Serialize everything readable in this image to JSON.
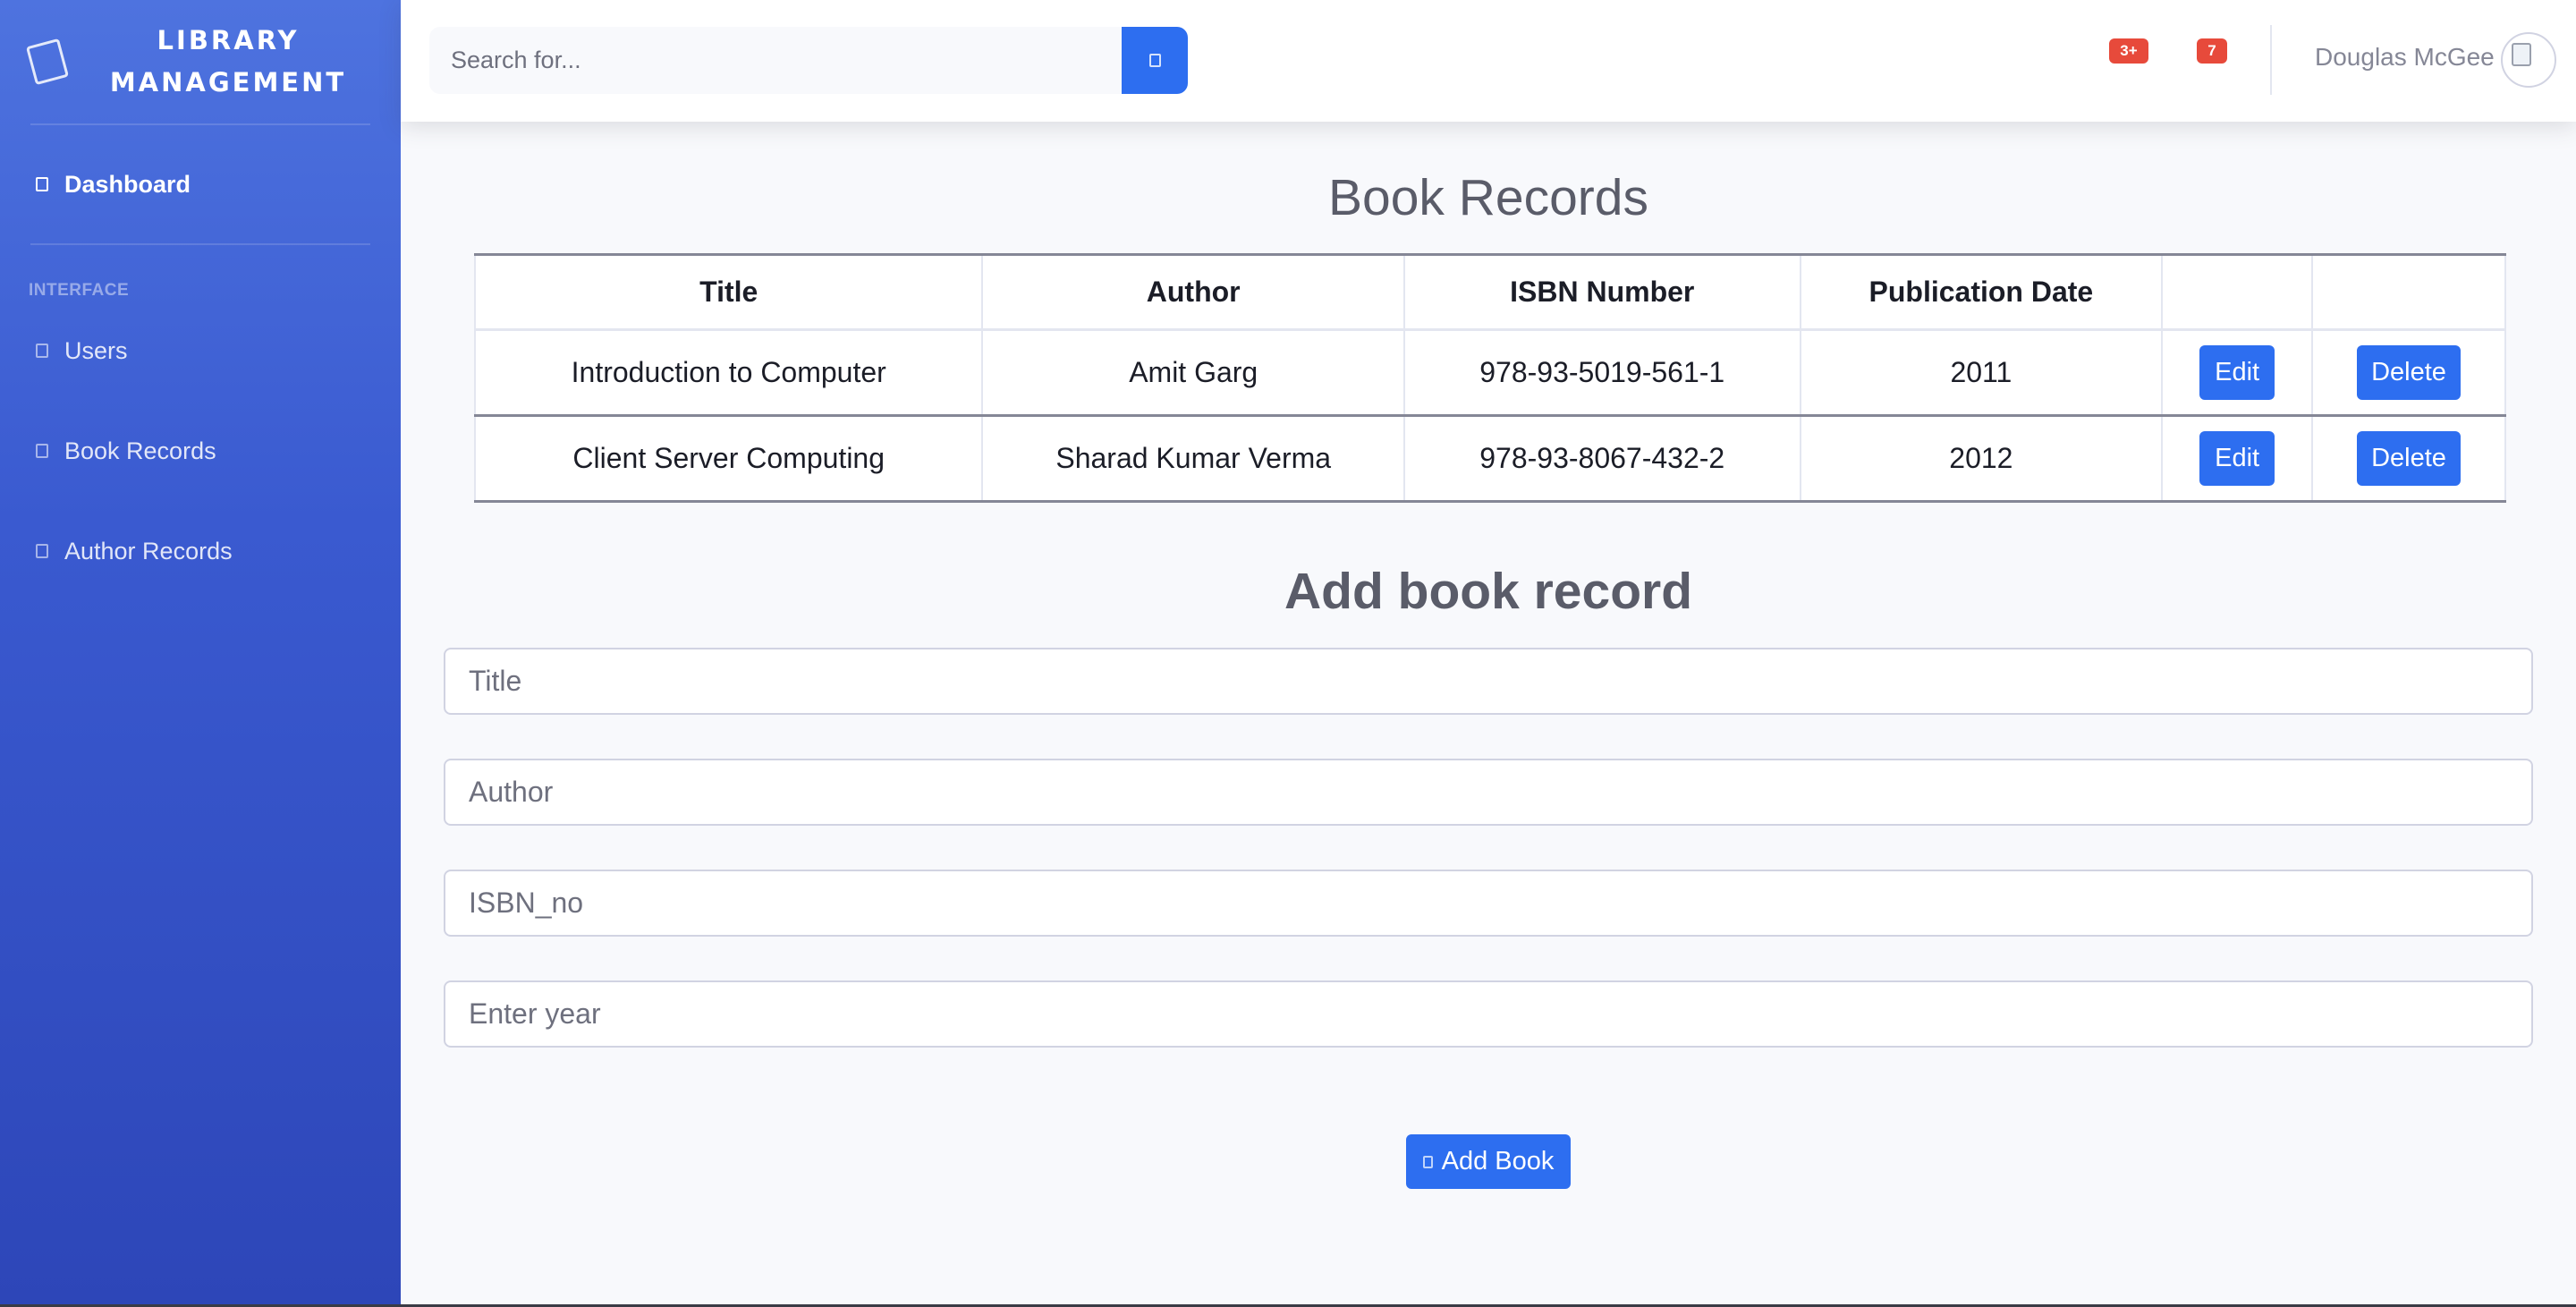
{
  "brand": {
    "line1": "LIBRARY",
    "line2": "MANAGEMENT"
  },
  "sidebar": {
    "dashboard_label": "Dashboard",
    "heading": "INTERFACE",
    "items": [
      {
        "label": "Users"
      },
      {
        "label": "Book Records"
      },
      {
        "label": "Author Records"
      }
    ]
  },
  "topbar": {
    "search_placeholder": "Search for...",
    "alerts_count": "3+",
    "messages_count": "7",
    "user_name": "Douglas McGee"
  },
  "page": {
    "title": "Book Records"
  },
  "table": {
    "headers": [
      "Title",
      "Author",
      "ISBN Number",
      "Publication Date",
      "",
      ""
    ],
    "rows": [
      {
        "title": "Introduction to Computer",
        "author": "Amit Garg",
        "isbn": "978-93-5019-561-1",
        "date": "2011",
        "edit": "Edit",
        "delete": "Delete"
      },
      {
        "title": "Client Server Computing",
        "author": "Sharad Kumar Verma",
        "isbn": "978-93-8067-432-2",
        "date": "2012",
        "edit": "Edit",
        "delete": "Delete"
      }
    ]
  },
  "form": {
    "title": "Add book record",
    "title_placeholder": "Title",
    "author_placeholder": "Author",
    "isbn_placeholder": "ISBN_no",
    "year_placeholder": "Enter year",
    "submit_label": "Add Book"
  },
  "colors": {
    "primary": "#2d6ef0",
    "sidebar": "#4e73df",
    "badge": "#e74a3b"
  }
}
